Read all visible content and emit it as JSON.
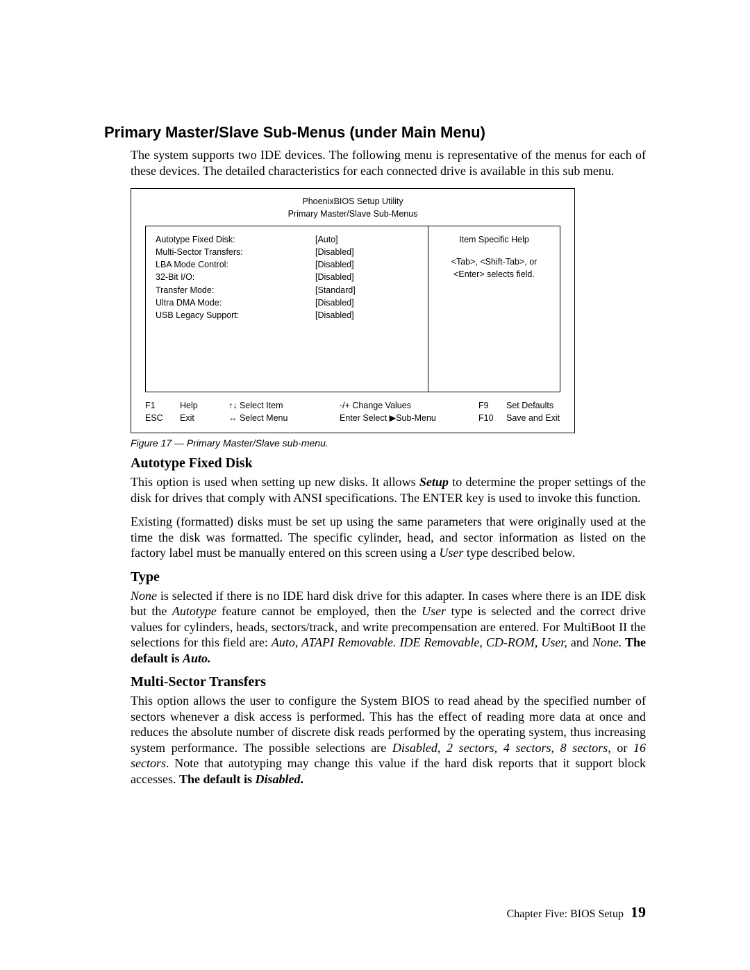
{
  "heading": "Primary Master/Slave Sub-Menus (under Main Menu)",
  "intro": "The system supports two IDE devices. The following menu is representative of the menus for each of these devices. The detailed characteristics for each connected drive is available in this sub menu.",
  "bios": {
    "title1": "PhoenixBIOS Setup Utility",
    "title2": "Primary Master/Slave Sub-Menus",
    "items": [
      {
        "label": "Autotype Fixed Disk:",
        "value": "[Auto]"
      },
      {
        "label": "Multi-Sector Transfers:",
        "value": "[Disabled]"
      },
      {
        "label": "LBA Mode Control:",
        "value": "[Disabled]"
      },
      {
        "label": "32-Bit I/O:",
        "value": "[Disabled]"
      },
      {
        "label": "Transfer Mode:",
        "value": "[Standard]"
      },
      {
        "label": "Ultra DMA Mode:",
        "value": "[Disabled]"
      },
      {
        "label": "USB Legacy Support:",
        "value": "[Disabled]"
      }
    ],
    "help_title": "Item Specific Help",
    "help_line1": "<Tab>, <Shift-Tab>, or",
    "help_line2": "<Enter> selects field.",
    "footer": {
      "r1": {
        "k1": "F1",
        "k2": "Help",
        "k3": "↑↓ Select Item",
        "k4": "-/+ Change Values",
        "k5": "F9",
        "k6": "Set Defaults"
      },
      "r2": {
        "k1": "ESC",
        "k2": "Exit",
        "k3": "↔ Select Menu",
        "k4": "Enter Select ▶Sub-Menu",
        "k5": "F10",
        "k6": "Save and Exit"
      }
    }
  },
  "figure_caption": "Figure 17 — Primary Master/Slave sub-menu.",
  "sections": {
    "autotype": {
      "heading": "Autotype Fixed Disk",
      "p1_a": "This option is used when setting up new disks. It allows ",
      "p1_b": "Setup",
      "p1_c": " to determine the proper settings of the disk for drives that comply with ANSI specifications. The ENTER key is used to invoke this function.",
      "p2_a": "Existing (formatted) disks must be set up using the same parameters that were originally used at the time the disk was formatted. The specific cylinder, head, and sector information as listed on the factory label must be manually entered on this screen using a ",
      "p2_b": "User",
      "p2_c": " type described below."
    },
    "type": {
      "heading": "Type",
      "p1_a": "None",
      "p1_b": " is selected if there is no IDE hard disk drive for this adapter. In cases where there is an IDE disk but the ",
      "p1_c": "Autotype",
      "p1_d": " feature cannot be employed, then the ",
      "p1_e": "User",
      "p1_f": " type is selected and the correct drive values for cylinders, heads, sectors/track, and write precompensation are entered. For MultiBoot II the selections for this field are: ",
      "p1_g": "Auto, ATAPI Removable. IDE Removable, CD-ROM, User,",
      "p1_h": " and ",
      "p1_i": "None.",
      "p1_j": " The default is ",
      "p1_k": "Auto."
    },
    "multisector": {
      "heading": "Multi-Sector Transfers",
      "p1_a": "This option allows the user to configure the System BIOS to read ahead by the specified number of sectors whenever a disk access is performed. This has the effect of reading more data at once and reduces the absolute number of discrete disk reads performed by the operating system, thus increasing system performance. The possible selections are ",
      "p1_b": "Disabled, 2 sectors, 4 sectors, 8 sectors,",
      "p1_c": " or ",
      "p1_d": "16 sectors",
      "p1_e": ". Note that autotyping may change this value if the hard disk reports that it support block accesses. ",
      "p1_f": "The default is ",
      "p1_g": "Disabled",
      "p1_h": "."
    }
  },
  "footer": {
    "chapter": "Chapter Five:  BIOS Setup",
    "page": "19"
  }
}
